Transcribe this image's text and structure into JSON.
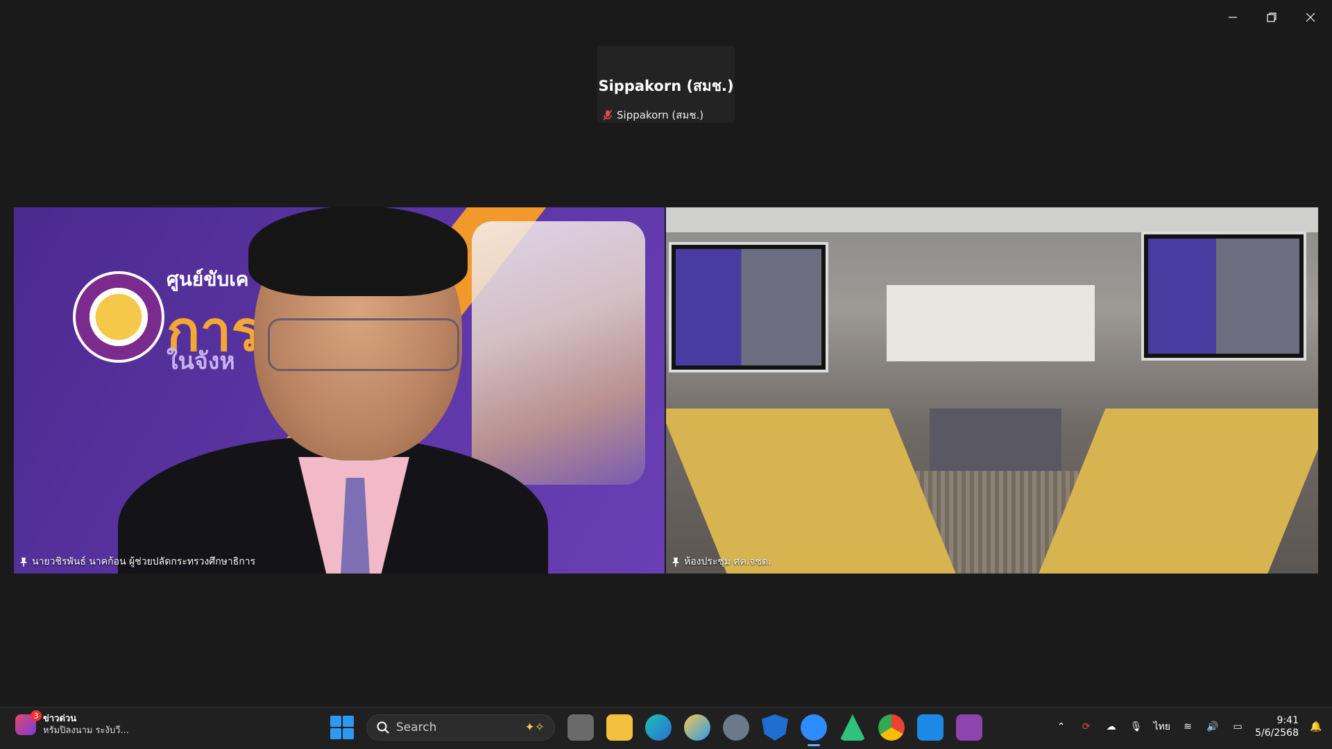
{
  "window": {
    "controls": [
      "minimize",
      "restore",
      "close"
    ]
  },
  "self_view": {
    "display_name": "Sippakorn (สมช.)",
    "label": "Sippakorn (สมช.)"
  },
  "tiles": {
    "left": {
      "label": "นายวชิรพันธ์ นาคก้อน ผู้ช่วยปลัดกระทรวงศึกษาธิการ",
      "backdrop_title": "ศูนย์ขับเค",
      "backdrop_big": "การ",
      "backdrop_sub": "ในจังห"
    },
    "right": {
      "label": "ห้องประชุม ศค.จชต.",
      "active_color": "#2fd27c"
    }
  },
  "taskbar": {
    "news": {
      "badge": "3",
      "title": "ข่าวด่วน",
      "subtitle": "หรัมปิลงนาม ระงับวี..."
    },
    "search_placeholder": "Search",
    "apps": [
      "task-view",
      "file-explorer",
      "edge",
      "weather",
      "settings",
      "defender",
      "zoom",
      "app-a",
      "chrome",
      "media-player",
      "pdf-app"
    ],
    "language": "ไทย",
    "time": "9:41",
    "date": "5/6/2568"
  }
}
